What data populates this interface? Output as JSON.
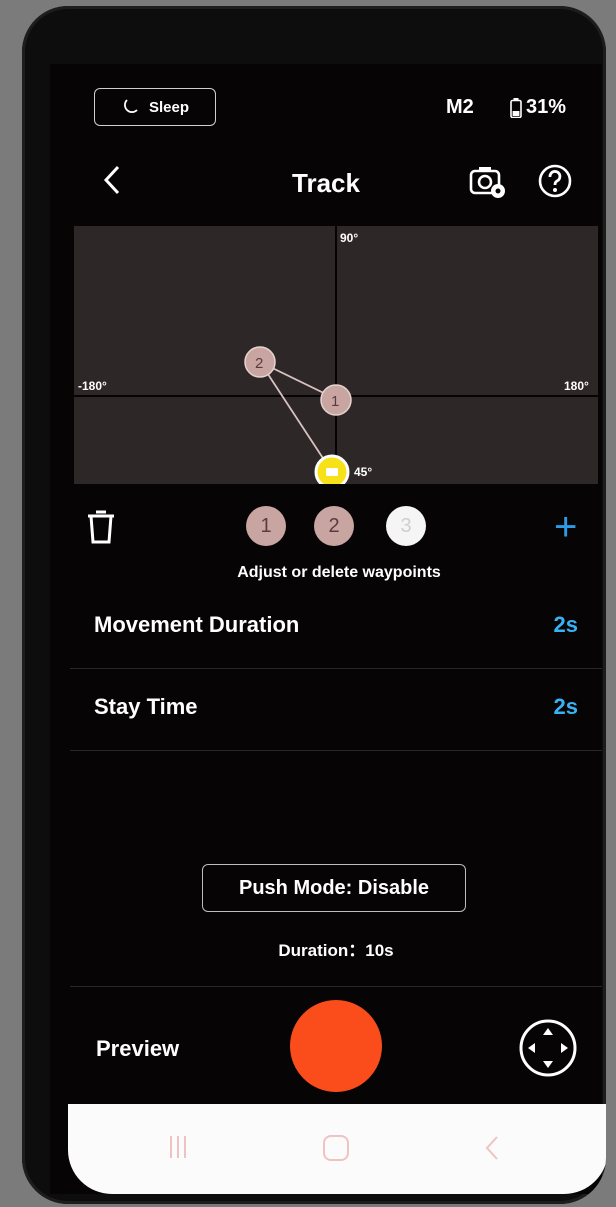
{
  "status_bar": {
    "sleep_label": "Sleep",
    "mode": "M2",
    "battery": "31%"
  },
  "header": {
    "title": "Track"
  },
  "track_grid": {
    "top_label": "90°",
    "left_label": "-180°",
    "right_label": "180°",
    "bottom_label": "45°",
    "waypoint_1_label": "1",
    "waypoint_2_label": "2"
  },
  "waypoints": {
    "items": [
      "1",
      "2",
      "3"
    ],
    "hint": "Adjust or delete waypoints"
  },
  "settings": {
    "movement_duration_label": "Movement Duration",
    "movement_duration_value": "2s",
    "stay_time_label": "Stay Time",
    "stay_time_value": "2s"
  },
  "push_mode": {
    "label": "Push Mode: Disable",
    "duration": "Duration：10s"
  },
  "bottom": {
    "preview_label": "Preview"
  },
  "colors": {
    "accent_blue": "#37b3f5",
    "record_red": "#fb4c1c",
    "waypoint_pink": "#c9a5a2",
    "current_waypoint_yellow": "#f7e21a"
  }
}
